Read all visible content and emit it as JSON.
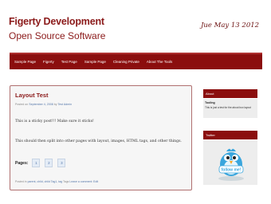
{
  "header": {
    "title": "Figerty Development",
    "subtitle": "Open Source Software",
    "date": "Jue May 13 2012"
  },
  "nav": {
    "items": [
      "Sample Page",
      "Figerty",
      "Test Page",
      "Sample Page",
      "Cleaning Private",
      "About The Tools"
    ]
  },
  "post": {
    "title": "Layout Test",
    "meta_prefix": "Posted on",
    "meta_date": "September 4, 2008",
    "meta_by": "by",
    "meta_author": "Test Admin",
    "p1": "This is a sticky post!!! Make sure it sticks!",
    "p2": "This should then split into other pages with layout, images, HTML tags, and other things.",
    "pages_label": "Pages:",
    "pages": [
      "1",
      "2",
      "3"
    ],
    "footer_prefix": "Posted in",
    "footer_links": "parent, child, child Tag1, tag",
    "footer_suffix": "Tags",
    "footer_comment": "Leave a comment: Edit"
  },
  "sidebar": {
    "about_title": "About",
    "about_name": "Tooling",
    "about_text": "This is just a test for the about box layout",
    "twitter_title": "Twitter",
    "twitter_badge": "follow me!"
  },
  "colors": {
    "brand": "#8b1a1a",
    "nav_bg": "#8b0e0e",
    "twitter_blue": "#3aa6dd"
  }
}
